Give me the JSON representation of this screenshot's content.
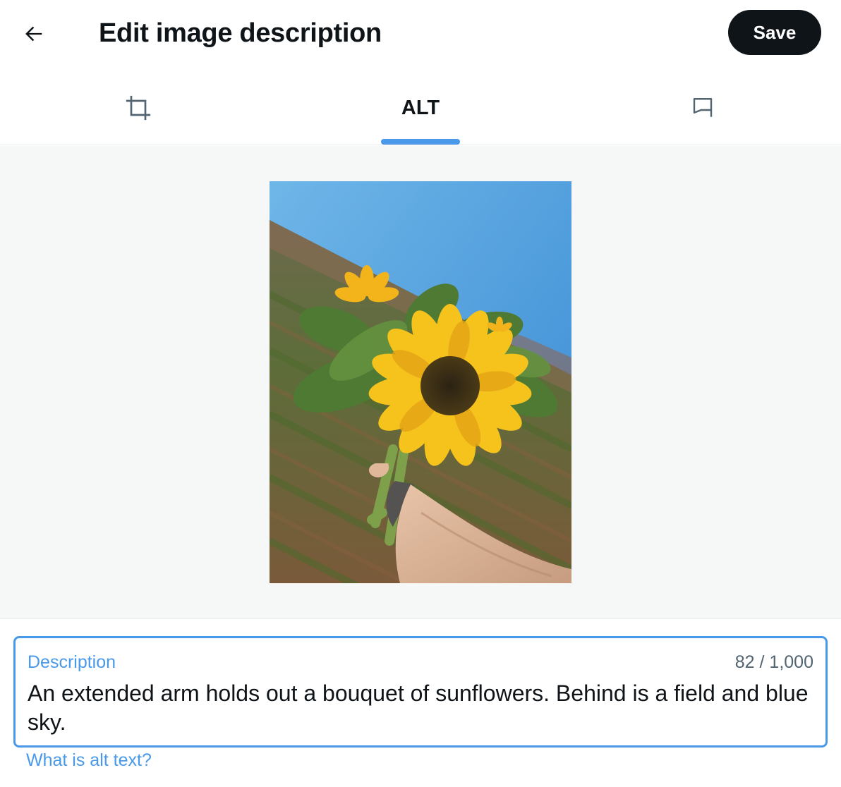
{
  "header": {
    "back_icon": "arrow-left-icon",
    "title": "Edit image description",
    "save_label": "Save"
  },
  "tabs": [
    {
      "id": "crop",
      "icon": "crop-icon",
      "label": ""
    },
    {
      "id": "alt",
      "icon": "",
      "label": "ALT",
      "selected": true
    },
    {
      "id": "flag",
      "icon": "flag-icon",
      "label": ""
    }
  ],
  "image": {
    "subject": "sunflower-bouquet-photo"
  },
  "description": {
    "label": "Description",
    "count": "82 / 1,000",
    "value": "An extended arm holds out a bouquet of sunflowers. Behind is a field and blue sky."
  },
  "help": {
    "link_label": "What is alt text?"
  },
  "colors": {
    "accent": "#4a99e9",
    "text": "#0f1419",
    "muted": "#536471",
    "save_bg": "#0f1419",
    "preview_bg": "#f6f7f7"
  }
}
